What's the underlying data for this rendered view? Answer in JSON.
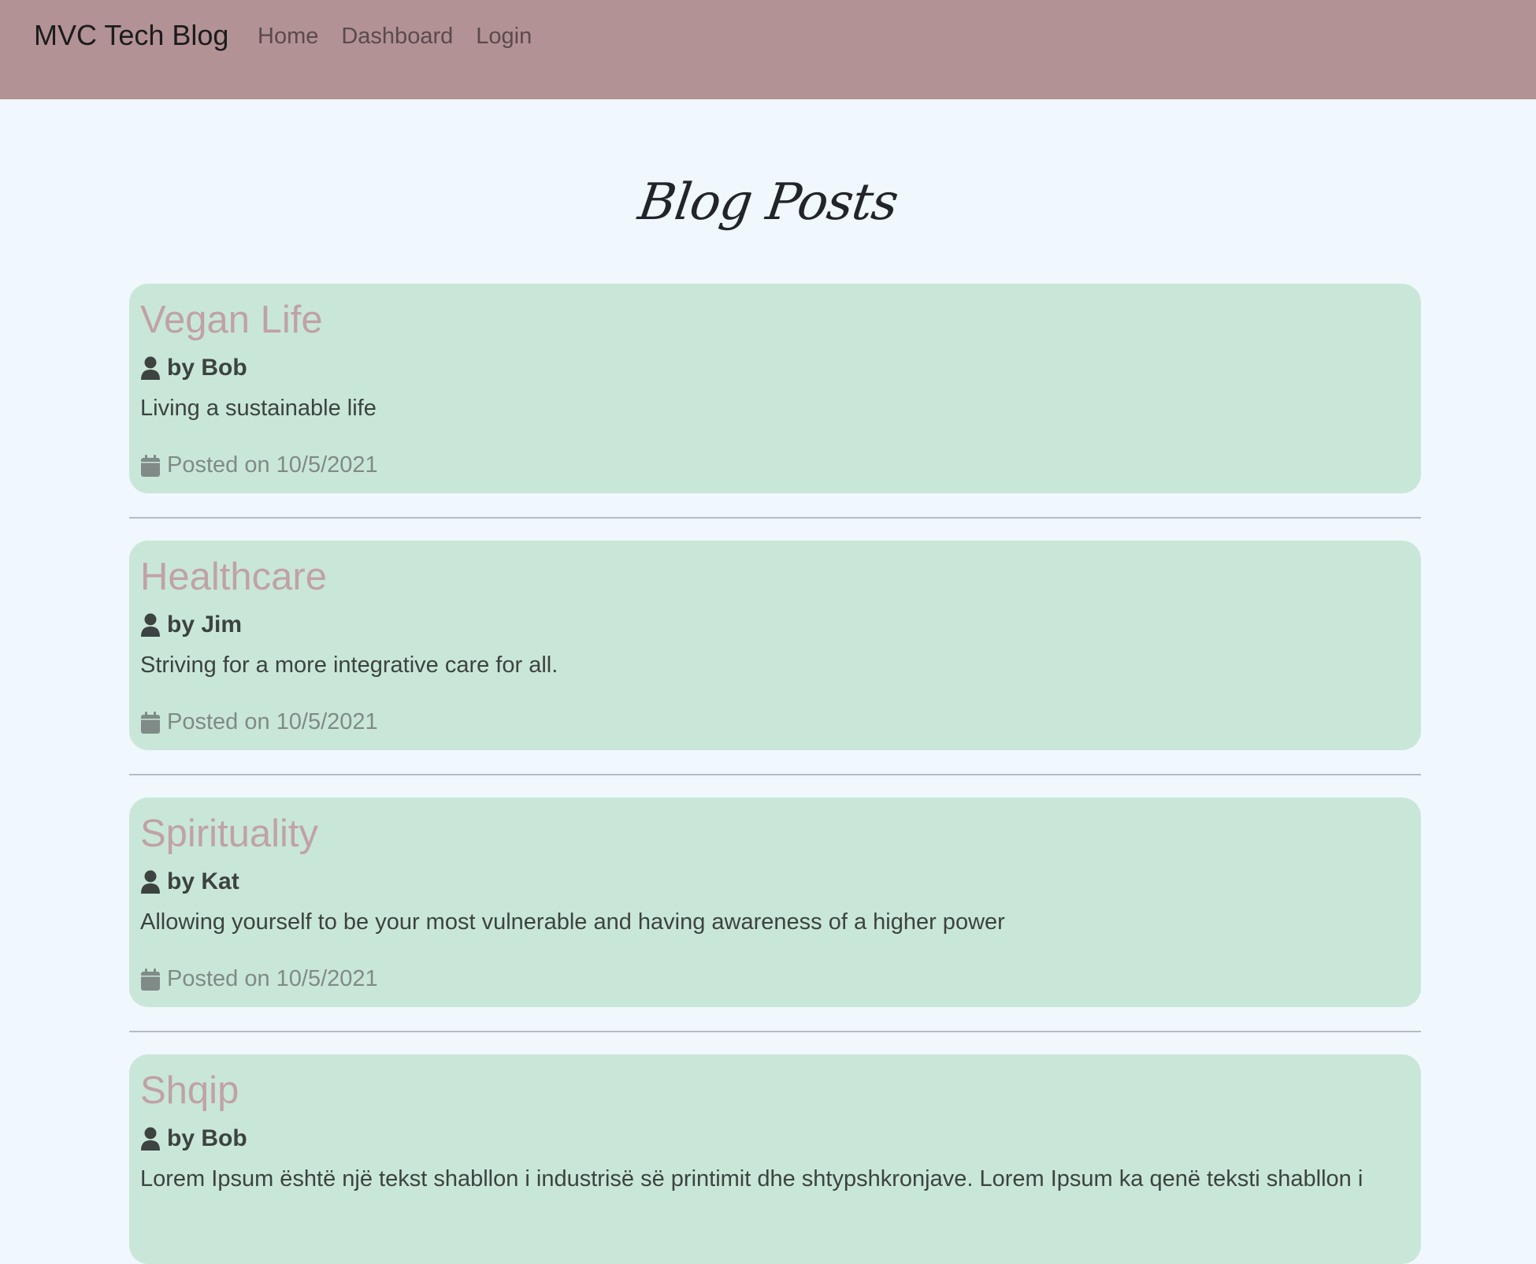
{
  "navbar": {
    "brand": "MVC Tech Blog",
    "links": [
      {
        "label": "Home"
      },
      {
        "label": "Dashboard"
      },
      {
        "label": "Login"
      }
    ]
  },
  "main": {
    "title": "Blog Posts",
    "posts": [
      {
        "title": "Vegan Life",
        "author": "by Bob",
        "body": "Living a sustainable life",
        "posted": "Posted on 10/5/2021"
      },
      {
        "title": "Healthcare",
        "author": "by Jim",
        "body": "Striving for a more integrative care for all.",
        "posted": "Posted on 10/5/2021"
      },
      {
        "title": "Spirituality",
        "author": "by Kat",
        "body": "Allowing yourself to be your most vulnerable and having awareness of a higher power",
        "posted": "Posted on 10/5/2021"
      },
      {
        "title": "Shqip",
        "author": "by Bob",
        "body": "Lorem Ipsum është një tekst shabllon i industrisë së printimit dhe shtypshkronjave. Lorem Ipsum ka qenë teksti shabllon i",
        "posted": ""
      }
    ]
  },
  "icons": {
    "author": "user-icon",
    "posted": "calendar-icon"
  },
  "colors": {
    "navbar": "#b39295",
    "background": "#f0f7fd",
    "card": "#c9e7d8",
    "card_title": "#c0a2a6"
  }
}
